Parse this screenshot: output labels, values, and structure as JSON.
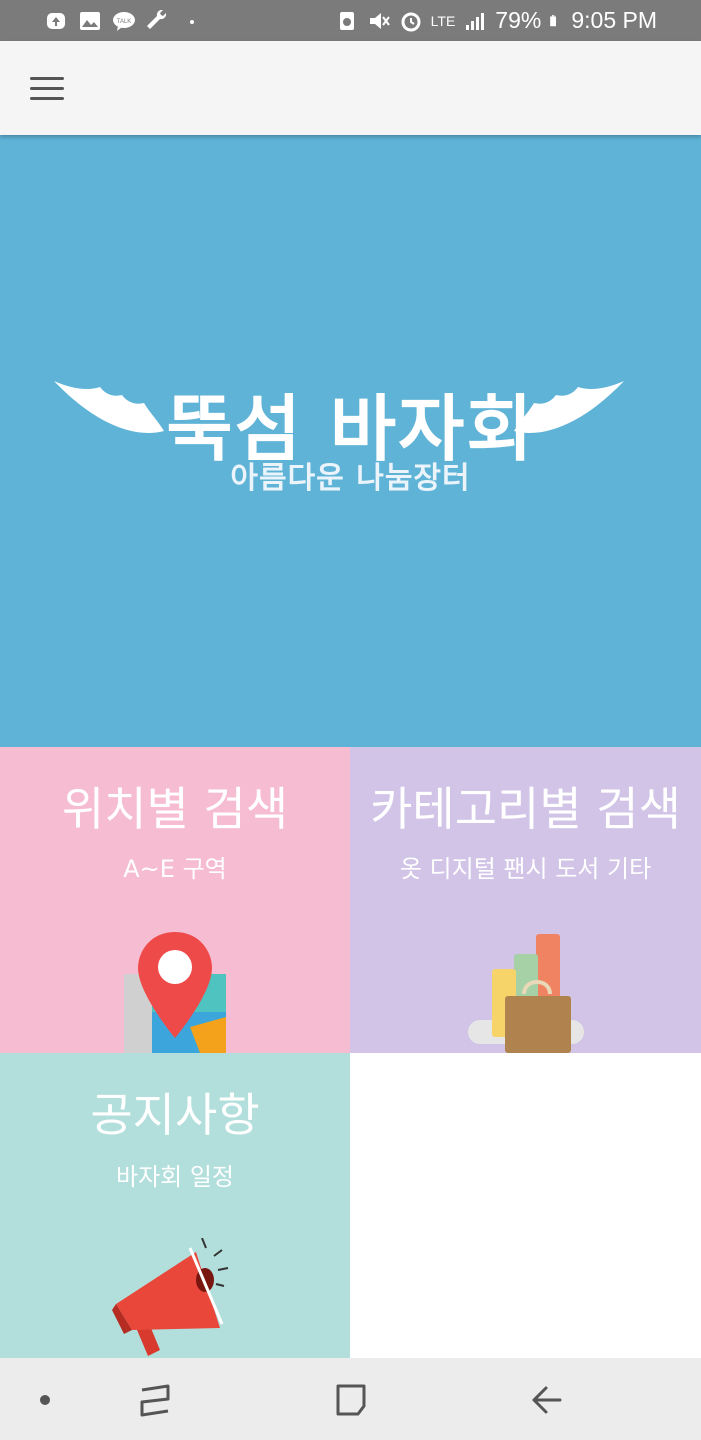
{
  "status_bar": {
    "left_icons": [
      "upload-icon",
      "gallery-icon",
      "kakaotalk-icon",
      "wrench-icon",
      "dot-icon"
    ],
    "right_icons": [
      "recycle-icon",
      "vibrate-icon",
      "alarm-icon",
      "lte-icon",
      "signal-icon",
      "battery-icon"
    ],
    "network": "LTE",
    "battery": "79%",
    "time": "9:05 PM"
  },
  "app_bar": {
    "menu_icon": "hamburger-menu-icon"
  },
  "banner": {
    "title": "뚝섬 바자회",
    "subtitle": "아름다운 나눔장터",
    "color": "#5fb3d7",
    "icons": [
      "wing-left-icon",
      "wing-right-icon"
    ]
  },
  "tiles": [
    {
      "title": "위치별 검색",
      "subtitle": "A~E 구역",
      "color": "#f6bcd2",
      "icon": "map-pin-icon"
    },
    {
      "title": "카테고리별 검색",
      "subtitle": "옷 디지털 팬시 도서 기타",
      "color": "#d1c4e7",
      "icon": "shopping-bag-icon"
    },
    {
      "title": "공지사항",
      "subtitle": "바자회 일정",
      "color": "#b2dfdc",
      "icon": "megaphone-icon"
    }
  ],
  "nav_bar": {
    "items": [
      "dot-icon",
      "recent-apps-icon",
      "home-icon",
      "back-icon"
    ]
  }
}
